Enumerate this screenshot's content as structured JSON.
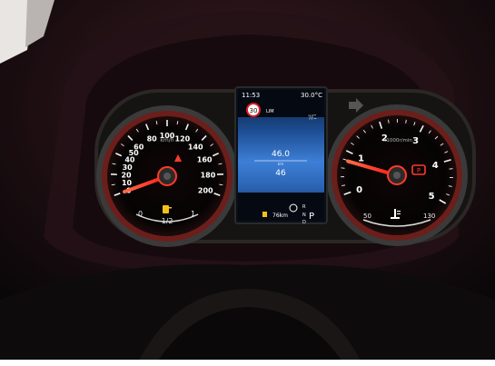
{
  "speedometer": {
    "ticks": [
      {
        "label": "0",
        "value": 0
      },
      {
        "label": "10",
        "value": 10
      },
      {
        "label": "20",
        "value": 20
      },
      {
        "label": "30",
        "value": 30
      },
      {
        "label": "40",
        "value": 40
      },
      {
        "label": "50",
        "value": 50
      },
      {
        "label": "60",
        "value": 60
      },
      {
        "label": "80",
        "value": 80
      },
      {
        "label": "100",
        "value": 100
      },
      {
        "label": "120",
        "value": 120
      },
      {
        "label": "140",
        "value": 140
      },
      {
        "label": "160",
        "value": 160
      },
      {
        "label": "180",
        "value": 180
      },
      {
        "label": "200",
        "value": 200
      }
    ],
    "unit": "km/h",
    "needle_value": 0,
    "fuel_empty": "0",
    "fuel_half": "1/2",
    "fuel_full": "1"
  },
  "tachometer": {
    "ticks": [
      "0",
      "1",
      "2",
      "3",
      "4",
      "5"
    ],
    "unit": "x1000r/min",
    "needle_value": 1,
    "temp_low": "50",
    "temp_high": "130"
  },
  "center_display": {
    "time": "11:53",
    "temperature": "30.0°C",
    "speed_limit": "30",
    "lim_label": "LIM",
    "odometer": "46.0",
    "odometer_unit": "km",
    "trip": "46",
    "range": "76km",
    "gear": "P",
    "gear_letters": [
      "R",
      "N",
      "D"
    ]
  },
  "colors": {
    "needle": "#ff2a1c",
    "backlight": "#ff3a2a",
    "display_blue": "#3d7fd6",
    "gauge_white": "#f2f2f2"
  }
}
